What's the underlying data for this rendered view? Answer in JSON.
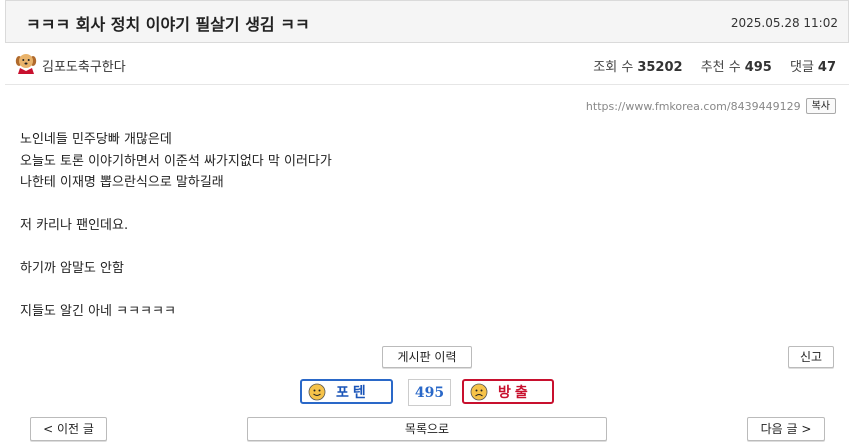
{
  "post": {
    "title": "ㅋㅋㅋ 회사 정치 이야기 필살기 생김 ㅋㅋ",
    "date": "2025.05.28 11:02"
  },
  "author": {
    "name": "김포도축구한다",
    "avatar_icon": "dog-avatar-icon"
  },
  "stats": {
    "views_label": "조회 수",
    "views": "35202",
    "likes_label": "추천 수",
    "likes": "495",
    "comments_label": "댓글",
    "comments": "47"
  },
  "link": {
    "url": "https://www.fmkorea.com/8439449129",
    "copy_label": "복사"
  },
  "content": {
    "lines": [
      "노인네들 민주당빠 개많은데",
      "오늘도 토론 이야기하면서 이준석 싸가지없다 막 이러다가",
      "나한테 이재명 뽑으란식으로 말하길래",
      "",
      "저 카리나 팬인데요.",
      "",
      "하기까 암말도 안함",
      "",
      "지들도 알긴 아네 ㅋㅋㅋㅋㅋ"
    ]
  },
  "actions": {
    "history_label": "게시판 이력",
    "report_label": "신고",
    "upvote_label": "포텐",
    "vote_count": "495",
    "downvote_label": "방출",
    "prev_label": "< 이전 글",
    "list_label": "목록으로",
    "next_label": "다음 글 >"
  },
  "colors": {
    "upvote": "#2a68c8",
    "downvote": "#c8102e"
  }
}
